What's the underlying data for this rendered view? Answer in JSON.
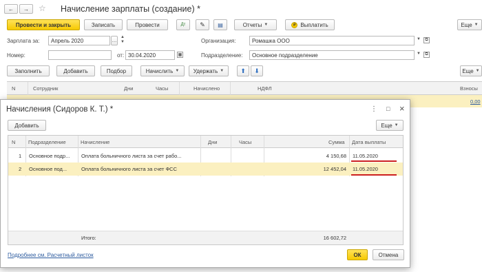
{
  "window": {
    "title": "Начисление зарплаты (создание) *",
    "nav_back": "←",
    "nav_forward": "→",
    "star": "☆",
    "more_label": "Еще"
  },
  "toolbar": {
    "post_close": "Провести и закрыть",
    "save": "Записать",
    "post": "Провести",
    "reports": "Отчеты",
    "pay": "Выплатить",
    "more": "Еще",
    "help": "?"
  },
  "form": {
    "salary_for_label": "Зарплата за:",
    "salary_for_value": "Апрель 2020",
    "number_label": "Номер:",
    "number_value": "",
    "date_from_label": "от:",
    "date_value": "30.04.2020",
    "org_label": "Организация:",
    "org_value": "Ромашка ООО",
    "dept_label": "Подразделение:",
    "dept_value": "Основное подразделение"
  },
  "table_toolbar": {
    "fill": "Заполнить",
    "add": "Добавить",
    "pick": "Подбор",
    "accrue": "Начислить",
    "withhold": "Удержать",
    "more": "Еще"
  },
  "main_table": {
    "columns": [
      "N",
      "Сотрудник",
      "Дни",
      "Часы",
      "Начислено",
      "НДФЛ",
      "Взносы"
    ],
    "row_value": "0,00"
  },
  "dialog": {
    "title": "Начисления (Сидоров К. Т.) *",
    "add": "Добавить",
    "more": "Еще",
    "columns": [
      "N",
      "Подразделение",
      "Начисление",
      "Дни",
      "Часы",
      "Сумма",
      "Дата выплаты"
    ],
    "rows": [
      {
        "n": "1",
        "dept": "Основное подр...",
        "accrual": "Оплата больничного листа за счет рабо...",
        "days": "",
        "hours": "",
        "sum": "4 150,68",
        "date": "11.05.2020"
      },
      {
        "n": "2",
        "dept": "Основное под...",
        "accrual": "Оплата больничного листа за счет ФСС",
        "days": "",
        "hours": "",
        "sum": "12 452,04",
        "date": "11.05.2020"
      }
    ],
    "total_label": "Итого:",
    "total_value": "16 602,72",
    "link": "Подробнее см. Расчетный листок",
    "ok": "ОК",
    "cancel": "Отмена",
    "menu_icon": "⋮",
    "minimize_icon": "—",
    "maximize_icon": "□",
    "close_icon": "×"
  },
  "colors": {
    "accent_yellow": "#f6c900",
    "selected_row": "#fbf0c0",
    "link_blue": "#2b5a9e",
    "underline_red": "#cc1f1f"
  }
}
